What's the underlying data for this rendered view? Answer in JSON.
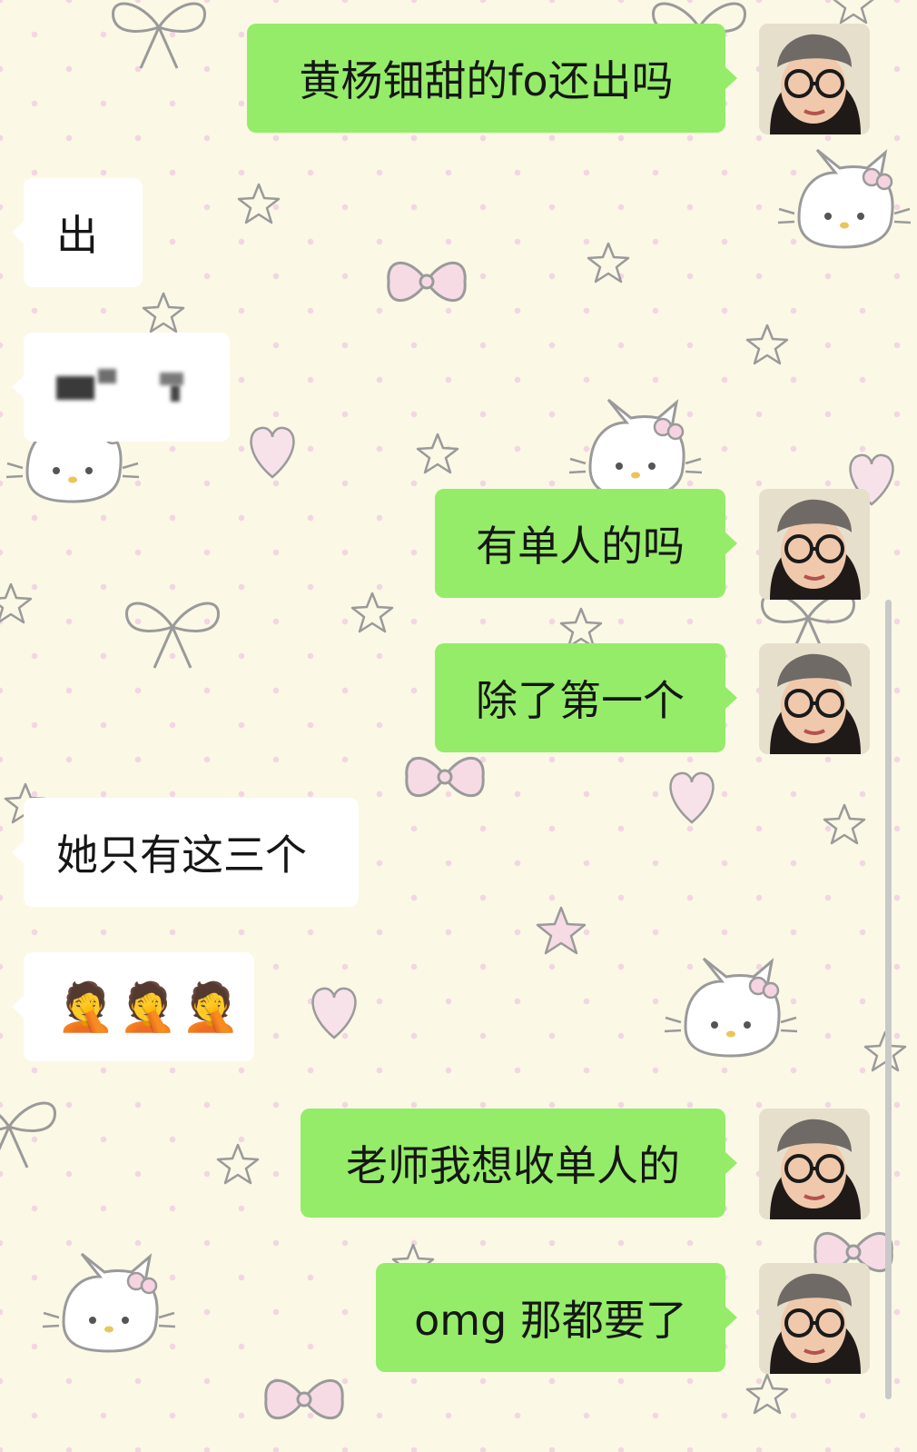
{
  "messages": [
    {
      "side": "out",
      "text": "黄杨钿甜的fo还出吗"
    },
    {
      "side": "in",
      "text": "出"
    },
    {
      "side": "in",
      "text": "",
      "redacted": true
    },
    {
      "side": "out",
      "text": "有单人的吗"
    },
    {
      "side": "out",
      "text": "除了第一个"
    },
    {
      "side": "in",
      "text": "她只有这三个"
    },
    {
      "side": "in",
      "text": "🤦🤦🤦",
      "emoji": "face-palm"
    },
    {
      "side": "out",
      "text": "老师我想收单人的"
    },
    {
      "side": "out",
      "text": "omg 那都要了"
    }
  ],
  "colors": {
    "outgoing_bubble": "#95ec69",
    "incoming_bubble": "#ffffff",
    "background": "#fbf8e6"
  },
  "background_theme": "hello-kitty-bows-stars-hearts",
  "avatar_icon": "user-avatar-glasses-hat"
}
